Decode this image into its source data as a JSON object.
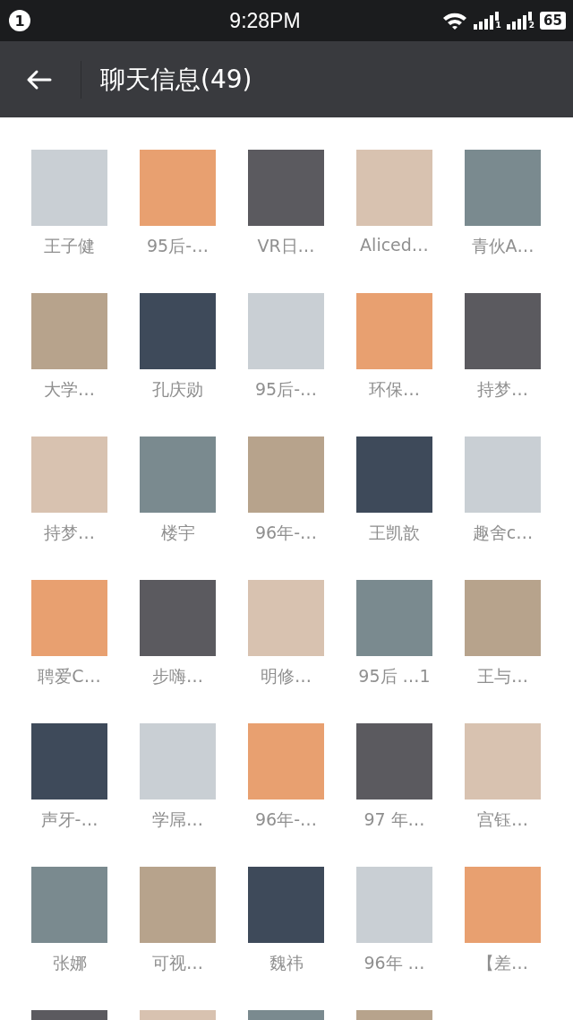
{
  "status_bar": {
    "notification_count": "1",
    "time": "9:28PM",
    "sim_slots": [
      "1",
      "2"
    ],
    "battery": "65"
  },
  "header": {
    "title": "聊天信息(49)"
  },
  "members": [
    {
      "kind": "member",
      "name": "王子健"
    },
    {
      "kind": "member",
      "name": "95后-…"
    },
    {
      "kind": "member",
      "name": "VR日…"
    },
    {
      "kind": "member",
      "name": "Aliced…"
    },
    {
      "kind": "member",
      "name": "青伙A…"
    },
    {
      "kind": "member",
      "name": "大学…"
    },
    {
      "kind": "member",
      "name": "孔庆勋"
    },
    {
      "kind": "member",
      "name": "95后-…"
    },
    {
      "kind": "member",
      "name": "环保…"
    },
    {
      "kind": "member",
      "name": "持梦…"
    },
    {
      "kind": "member",
      "name": "持梦…"
    },
    {
      "kind": "member",
      "name": "楼宇"
    },
    {
      "kind": "member",
      "name": "96年-…"
    },
    {
      "kind": "member",
      "name": "王凯歆"
    },
    {
      "kind": "member",
      "name": "趣舍c…"
    },
    {
      "kind": "member",
      "name": "聘爱C…"
    },
    {
      "kind": "member",
      "name": "步嗨…"
    },
    {
      "kind": "member",
      "name": "明修…"
    },
    {
      "kind": "member",
      "name": "95后 …1"
    },
    {
      "kind": "member",
      "name": "王与…"
    },
    {
      "kind": "member",
      "name": "声牙-…"
    },
    {
      "kind": "member",
      "name": "学屌…"
    },
    {
      "kind": "member",
      "name": "96年-…"
    },
    {
      "kind": "member",
      "name": "97 年…"
    },
    {
      "kind": "member",
      "name": "宫钰…"
    },
    {
      "kind": "member",
      "name": "张娜"
    },
    {
      "kind": "member",
      "name": "可视…"
    },
    {
      "kind": "member",
      "name": "魏祎"
    },
    {
      "kind": "member",
      "name": "96年 …"
    },
    {
      "kind": "member",
      "name": "【差…"
    },
    {
      "kind": "partial"
    },
    {
      "kind": "partial"
    },
    {
      "kind": "partial"
    },
    {
      "kind": "partial"
    }
  ]
}
